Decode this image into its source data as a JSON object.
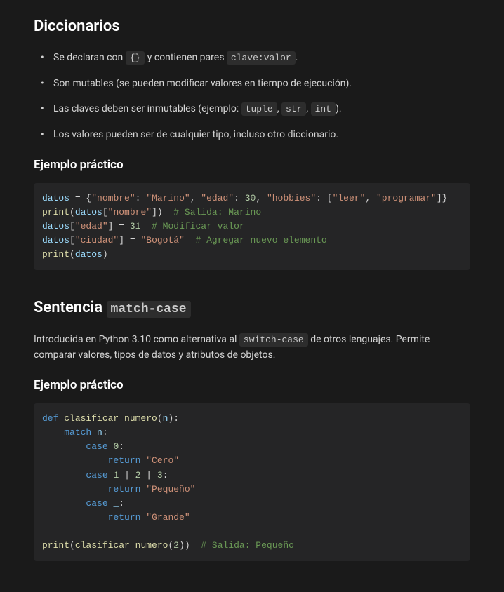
{
  "section1": {
    "heading": "Diccionarios",
    "bullets": [
      {
        "pre": "Se declaran con ",
        "code": "{}",
        "mid": " y contienen pares ",
        "code2": "clave:valor",
        "post": "."
      },
      {
        "pre": "Son mutables (se pueden modificar valores en tiempo de ejecución)."
      },
      {
        "pre": "Las claves deben ser inmutables (ejemplo: ",
        "code": "tuple",
        "mid": ", ",
        "code2": "str",
        "mid2": ", ",
        "code3": "int",
        "post": ")."
      },
      {
        "pre": "Los valores pueden ser de cualquier tipo, incluso otro diccionario."
      }
    ],
    "example_heading": "Ejemplo práctico",
    "code": {
      "line1": {
        "var": "datos",
        "eq": " = {",
        "k1": "\"nombre\"",
        "c1": ": ",
        "v1": "\"Marino\"",
        "c2": ", ",
        "k2": "\"edad\"",
        "c3": ": ",
        "v2": "30",
        "c4": ", ",
        "k3": "\"hobbies\"",
        "c5": ": [",
        "v3": "\"leer\"",
        "c6": ", ",
        "v4": "\"programar\"",
        "c7": "]}"
      },
      "line2": {
        "fn": "print",
        "p1": "(",
        "var": "datos",
        "p2": "[",
        "k": "\"nombre\"",
        "p3": "])  ",
        "cm": "# Salida: Marino"
      },
      "line3": {
        "var": "datos",
        "p1": "[",
        "k": "\"edad\"",
        "p2": "] = ",
        "v": "31",
        "sp": "  ",
        "cm": "# Modificar valor"
      },
      "line4": {
        "var": "datos",
        "p1": "[",
        "k": "\"ciudad\"",
        "p2": "] = ",
        "v": "\"Bogotá\"",
        "sp": "  ",
        "cm": "# Agregar nuevo elemento"
      },
      "line5": {
        "fn": "print",
        "p1": "(",
        "var": "datos",
        "p2": ")"
      }
    }
  },
  "section2": {
    "heading_pre": "Sentencia ",
    "heading_code": "match-case",
    "para_pre": "Introducida en Python 3.10 como alternativa al ",
    "para_code": "switch-case",
    "para_post": " de otros lenguajes. Permite comparar valores, tipos de datos y atributos de objetos.",
    "example_heading": "Ejemplo práctico",
    "code": {
      "l1": {
        "kw": "def",
        "sp": " ",
        "fn": "clasificar_numero",
        "p1": "(",
        "arg": "n",
        "p2": "):"
      },
      "l2": {
        "indent": "    ",
        "kw": "match",
        "sp": " ",
        "var": "n",
        "p": ":"
      },
      "l3": {
        "indent": "        ",
        "kw": "case",
        "sp": " ",
        "v": "0",
        "p": ":"
      },
      "l4": {
        "indent": "            ",
        "kw": "return",
        "sp": " ",
        "v": "\"Cero\""
      },
      "l5": {
        "indent": "        ",
        "kw": "case",
        "sp": " ",
        "v1": "1",
        "p1": " | ",
        "v2": "2",
        "p2": " | ",
        "v3": "3",
        "p3": ":"
      },
      "l6": {
        "indent": "            ",
        "kw": "return",
        "sp": " ",
        "v": "\"Pequeño\""
      },
      "l7": {
        "indent": "        ",
        "kw": "case",
        "sp": " ",
        "v": "_",
        "p": ":"
      },
      "l8": {
        "indent": "            ",
        "kw": "return",
        "sp": " ",
        "v": "\"Grande\""
      },
      "l9": {
        "fn": "print",
        "p1": "(",
        "fn2": "clasificar_numero",
        "p2": "(",
        "v": "2",
        "p3": "))  ",
        "cm": "# Salida: Pequeño"
      }
    }
  }
}
